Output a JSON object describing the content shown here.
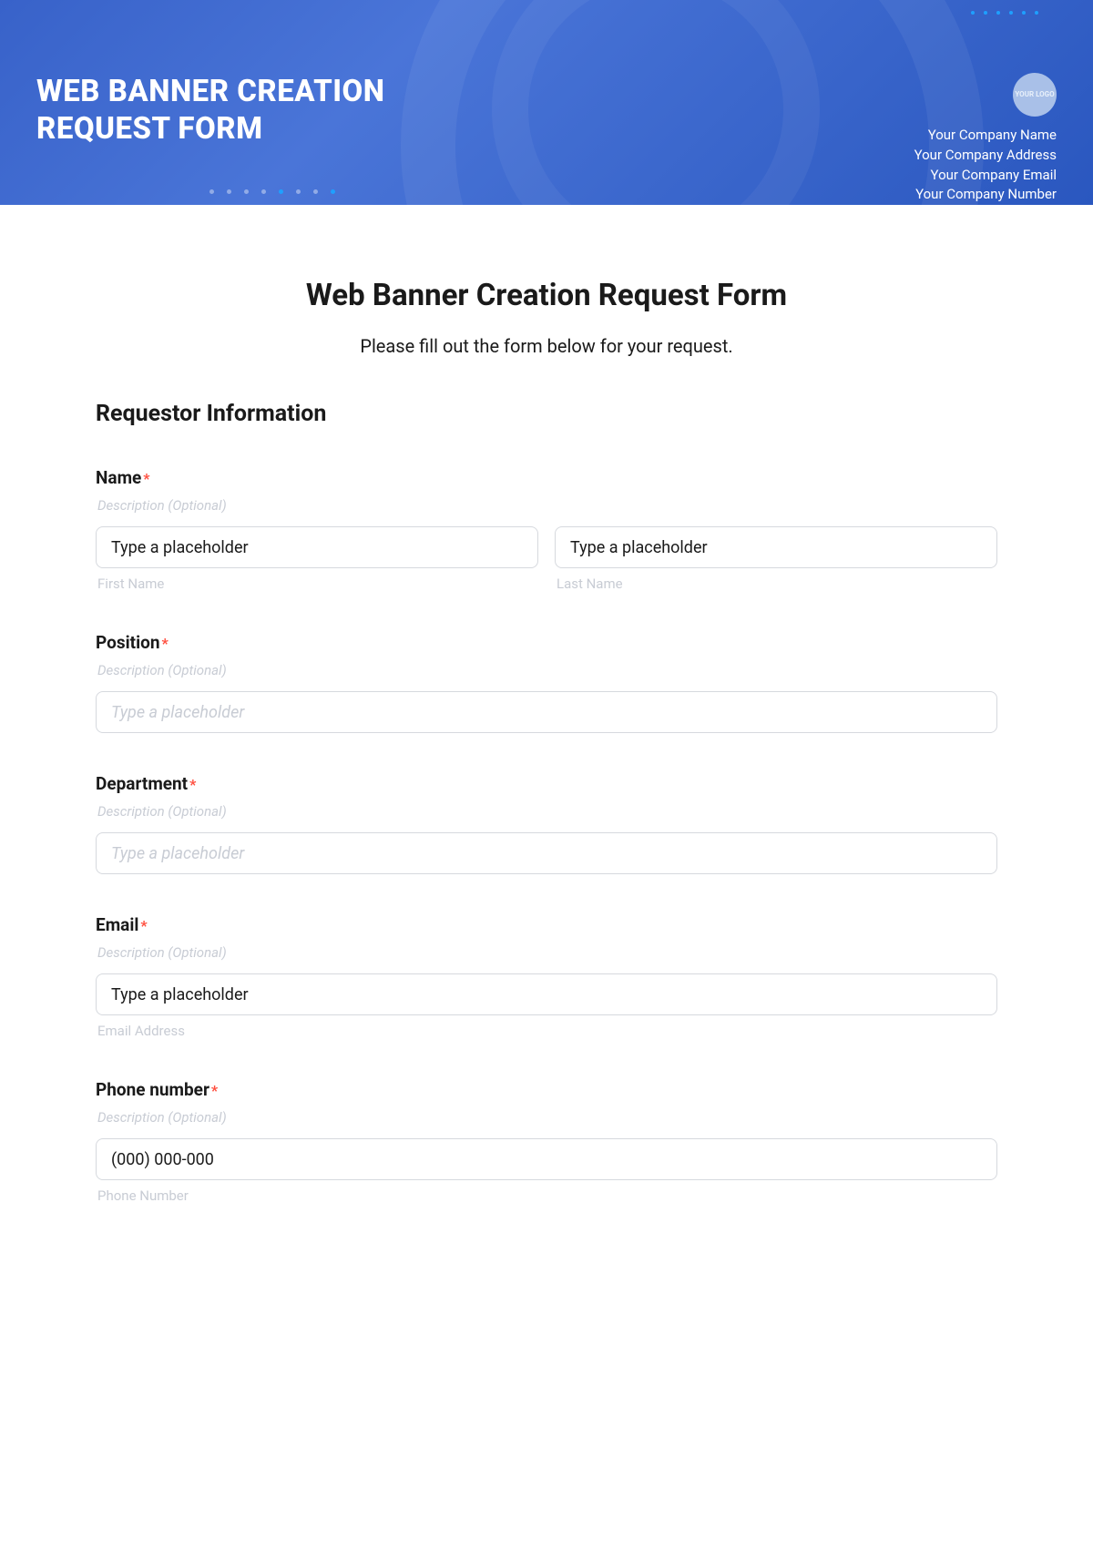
{
  "header": {
    "title": "WEB BANNER CREATION REQUEST FORM",
    "logo_text": "YOUR LOGO",
    "company_lines": [
      "Your Company Name",
      "Your Company Address",
      "Your Company Email",
      "Your Company Number"
    ]
  },
  "page": {
    "title": "Web Banner Creation Request Form",
    "subtitle": "Please fill out the form below for your request."
  },
  "section": {
    "title": "Requestor Information"
  },
  "fields": {
    "name": {
      "label": "Name",
      "desc": "Description (Optional)",
      "first_value": "Type a placeholder",
      "first_sub": "First Name",
      "last_value": "Type a placeholder",
      "last_sub": "Last Name"
    },
    "position": {
      "label": "Position",
      "desc": "Description (Optional)",
      "placeholder": "Type a placeholder"
    },
    "department": {
      "label": "Department",
      "desc": "Description (Optional)",
      "placeholder": "Type a placeholder"
    },
    "email": {
      "label": "Email",
      "desc": "Description (Optional)",
      "value": "Type a placeholder",
      "sub": "Email Address"
    },
    "phone": {
      "label": "Phone number",
      "desc": "Description (Optional)",
      "value": "(000) 000-000",
      "sub": "Phone Number"
    }
  },
  "required_marker": "*"
}
